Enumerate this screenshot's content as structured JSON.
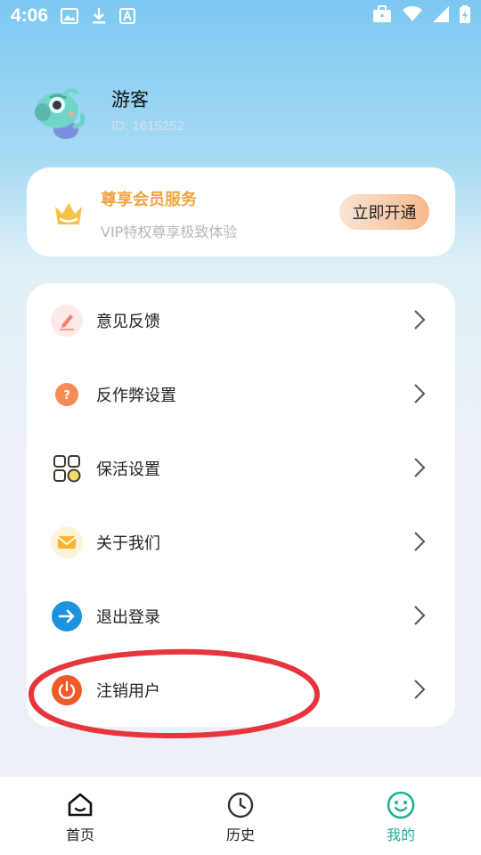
{
  "status_bar": {
    "time": "4:06"
  },
  "profile": {
    "name": "游客",
    "id_text": "ID: 1615252"
  },
  "vip": {
    "title": "尊享会员服务",
    "subtitle": "VIP特权尊享极致体验",
    "button_label": "立即开通",
    "accent_color": "#f1a340"
  },
  "menu": {
    "items": [
      {
        "label": "意见反馈",
        "icon": "feedback-icon"
      },
      {
        "label": "反作弊设置",
        "icon": "anti-cheat-icon"
      },
      {
        "label": "保活设置",
        "icon": "keep-alive-icon"
      },
      {
        "label": "关于我们",
        "icon": "mail-icon"
      },
      {
        "label": "退出登录",
        "icon": "logout-icon"
      },
      {
        "label": "注销用户",
        "icon": "power-icon"
      }
    ]
  },
  "bottom_nav": {
    "items": [
      {
        "label": "首页",
        "icon": "home-icon",
        "active": false
      },
      {
        "label": "历史",
        "icon": "clock-icon",
        "active": false
      },
      {
        "label": "我的",
        "icon": "smiley-icon",
        "active": true
      }
    ],
    "active_color": "#1fb094"
  },
  "annotation_color": "#e8353d"
}
